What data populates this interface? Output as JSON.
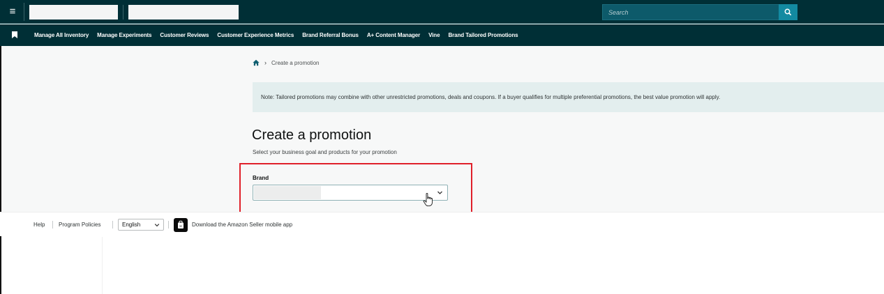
{
  "topbar": {
    "menu_glyph": "≡",
    "search": {
      "placeholder": "Search"
    }
  },
  "navbar": {
    "items": [
      "Manage All Inventory",
      "Manage Experiments",
      "Customer Reviews",
      "Customer Experience Metrics",
      "Brand Referral Bonus",
      "A+ Content Manager",
      "Vine",
      "Brand Tailored Promotions"
    ]
  },
  "breadcrumb": {
    "separator": "›",
    "current": "Create a promotion"
  },
  "note": {
    "text": "Note: Tailored promotions may combine with other unrestricted promotions, deals and coupons. If a buyer qualifies for multiple preferential promotions, the best value promotion will apply."
  },
  "main": {
    "title": "Create a promotion",
    "subtitle": "Select your business goal and products for your promotion",
    "brand_label": "Brand"
  },
  "footer": {
    "help": "Help",
    "program_policies": "Program Policies",
    "language": "English",
    "download_app": "Download the Amazon Seller mobile app"
  },
  "colors": {
    "header_bg": "#002f36",
    "search_bg": "#0d5a6a",
    "search_button": "#138aa1",
    "note_bg": "#e3eeee",
    "highlight": "#e0202a"
  },
  "icons": {
    "menu": "hamburger-icon",
    "search": "search-icon",
    "bookmark": "bookmark-icon",
    "home": "home-icon",
    "select": "chevron-down-icon",
    "cursor": "hand-cursor-icon",
    "app": "mobile-app-icon"
  }
}
